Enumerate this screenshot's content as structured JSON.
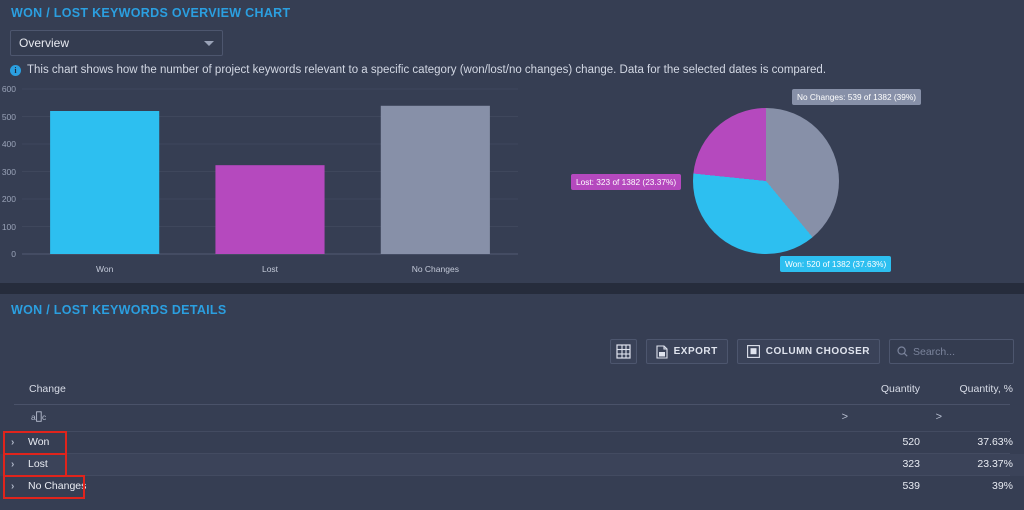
{
  "overview": {
    "title": "WON / LOST KEYWORDS OVERVIEW CHART",
    "select_value": "Overview",
    "select_icon": "chevron-down-icon",
    "info_icon": "info-icon",
    "info_text": "This chart shows how the number of project keywords relevant to a specific category (won/lost/no changes) change. Data for the selected dates is compared."
  },
  "chart_data": [
    {
      "type": "bar",
      "title": "",
      "categories": [
        "Won",
        "Lost",
        "No Changes"
      ],
      "values": [
        520,
        323,
        539
      ],
      "colors": [
        "#2dbff0",
        "#b549be",
        "#8790a8"
      ],
      "xlabel": "",
      "ylabel": "",
      "ylim": [
        0,
        600
      ],
      "yticks": [
        0,
        100,
        200,
        300,
        400,
        500,
        600
      ],
      "grid": true,
      "legend": "none"
    },
    {
      "type": "pie",
      "title": "",
      "total": 1382,
      "slices": [
        {
          "name": "No Changes",
          "value": 539,
          "percent": "39%",
          "color": "#8790a8",
          "label": "No Changes: 539 of 1382 (39%)"
        },
        {
          "name": "Won",
          "value": 520,
          "percent": "37.63%",
          "color": "#2dbff0",
          "label": "Won: 520 of 1382 (37.63%)"
        },
        {
          "name": "Lost",
          "value": 323,
          "percent": "23.37%",
          "color": "#b549be",
          "label": "Lost: 323 of 1382 (23.37%)"
        }
      ],
      "legend": "callout-labels"
    }
  ],
  "details": {
    "title": "WON / LOST KEYWORDS DETAILS",
    "toolbar": {
      "grid_icon": "grid-layout-icon",
      "export_icon": "export-file-icon",
      "export_label": "EXPORT",
      "column_chooser_icon": "column-chooser-icon",
      "column_chooser_label": "COLUMN CHOOSER",
      "search_icon": "search-icon",
      "search_placeholder": "Search...",
      "search_value": ""
    },
    "columns": [
      {
        "key": "change",
        "label": "Change",
        "filter_icon": "abc-filter-icon",
        "filter_op": ""
      },
      {
        "key": "quantity",
        "label": "Quantity",
        "filter_icon": "",
        "filter_op": ">"
      },
      {
        "key": "quantity_p",
        "label": "Quantity, %",
        "filter_icon": "",
        "filter_op": ">"
      }
    ],
    "rows": [
      {
        "expand_icon": "chevron-right-icon",
        "change": "Won",
        "quantity": "520",
        "quantity_percent": "37.63%",
        "highlight": true
      },
      {
        "expand_icon": "chevron-right-icon",
        "change": "Lost",
        "quantity": "323",
        "quantity_percent": "23.37%",
        "highlight": true
      },
      {
        "expand_icon": "chevron-right-icon",
        "change": "No Changes",
        "quantity": "539",
        "quantity_percent": "39%",
        "highlight": true
      }
    ],
    "highlight_color": "#e0241c"
  }
}
